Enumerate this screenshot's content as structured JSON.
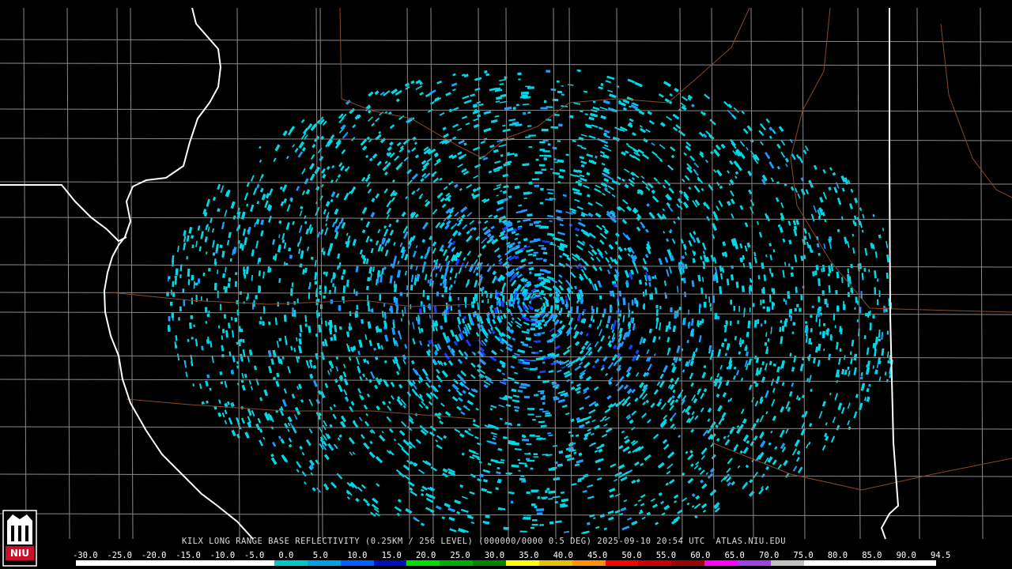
{
  "product": {
    "caption": "KILX LONG RANGE BASE REFLECTIVITY (0.25KM / 256 LEVEL) (000000/0000 0.5 DEG) 2025-09-10 20:54 UTC  ATLAS.NIU.EDU"
  },
  "logo": {
    "text": "NIU",
    "accent": "#c8102e"
  },
  "legend": {
    "labels": [
      "-30.0",
      "-25.0",
      "-20.0",
      "-15.0",
      "-10.0",
      "-5.0",
      "0.0",
      "5.0",
      "10.0",
      "15.0",
      "20.0",
      "25.0",
      "30.0",
      "35.0",
      "40.0",
      "45.0",
      "50.0",
      "55.0",
      "60.0",
      "65.0",
      "70.0",
      "75.0",
      "80.0",
      "85.0",
      "90.0",
      "94.5"
    ],
    "colors": [
      "#ffffff",
      "#ffffff",
      "#ffffff",
      "#ffffff",
      "#ffffff",
      "#ffffff",
      "#00c8c8",
      "#00a0e8",
      "#0060ff",
      "#0010c0",
      "#00e000",
      "#00b000",
      "#008800",
      "#ffff00",
      "#e8c000",
      "#ff9000",
      "#ff0000",
      "#d00000",
      "#a00000",
      "#ff00ff",
      "#a040e0",
      "#c0c0c0",
      "#ffffff",
      "#ffffff",
      "#ffffff",
      "#ffffff"
    ]
  },
  "map": {
    "colors": {
      "background": "#000000",
      "county_lines": "#8a8a8a",
      "state_lines": "#ffffff",
      "highways": "#8b4a2b",
      "echo_light": "#00d8e8",
      "echo_mid": "#1e9cff",
      "echo_strong": "#1a3cff"
    },
    "radar_site_marker": "radar-site-dot"
  }
}
